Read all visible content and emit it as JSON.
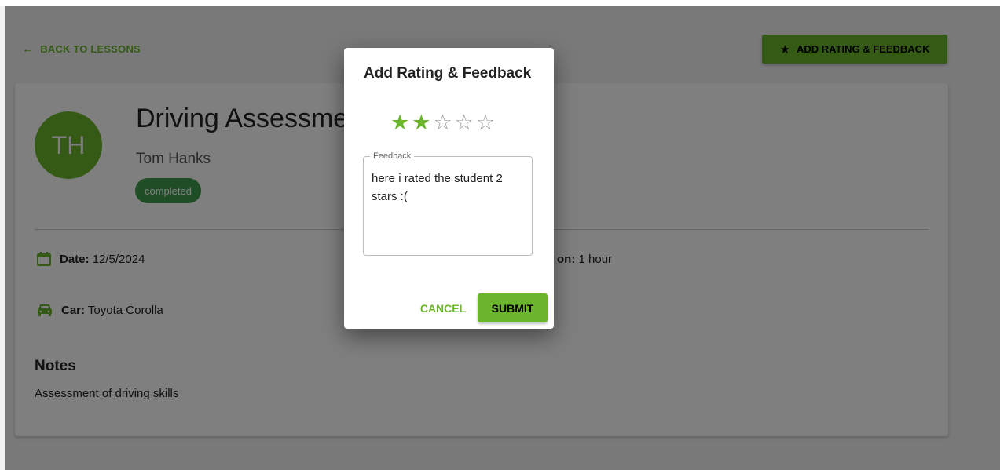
{
  "nav": {
    "back_label": "BACK TO LESSONS",
    "back_icon": "arrow-left-icon"
  },
  "actions": {
    "add_rating_label": "ADD RATING & FEEDBACK",
    "add_rating_icon": "star-icon"
  },
  "lesson": {
    "avatar_initials": "TH",
    "title": "Driving Assessment",
    "student": "Tom Hanks",
    "status": "completed",
    "date_label": "Date:",
    "date_value": "12/5/2024",
    "duration_label": "on:",
    "duration_value": "1 hour",
    "car_label": "Car:",
    "car_value": "Toyota Corolla",
    "notes_heading": "Notes",
    "notes_text": "Assessment of driving skills"
  },
  "dialog": {
    "title": "Add Rating & Feedback",
    "rating": 2,
    "max_rating": 5,
    "feedback_label": "Feedback",
    "feedback_value": "here i rated the student 2 stars :(",
    "cancel_label": "CANCEL",
    "submit_label": "SUBMIT"
  },
  "colors": {
    "accent": "#6bb52c",
    "status_badge": "#3e9a4a",
    "overlay": "rgba(0,0,0,0.5)"
  }
}
